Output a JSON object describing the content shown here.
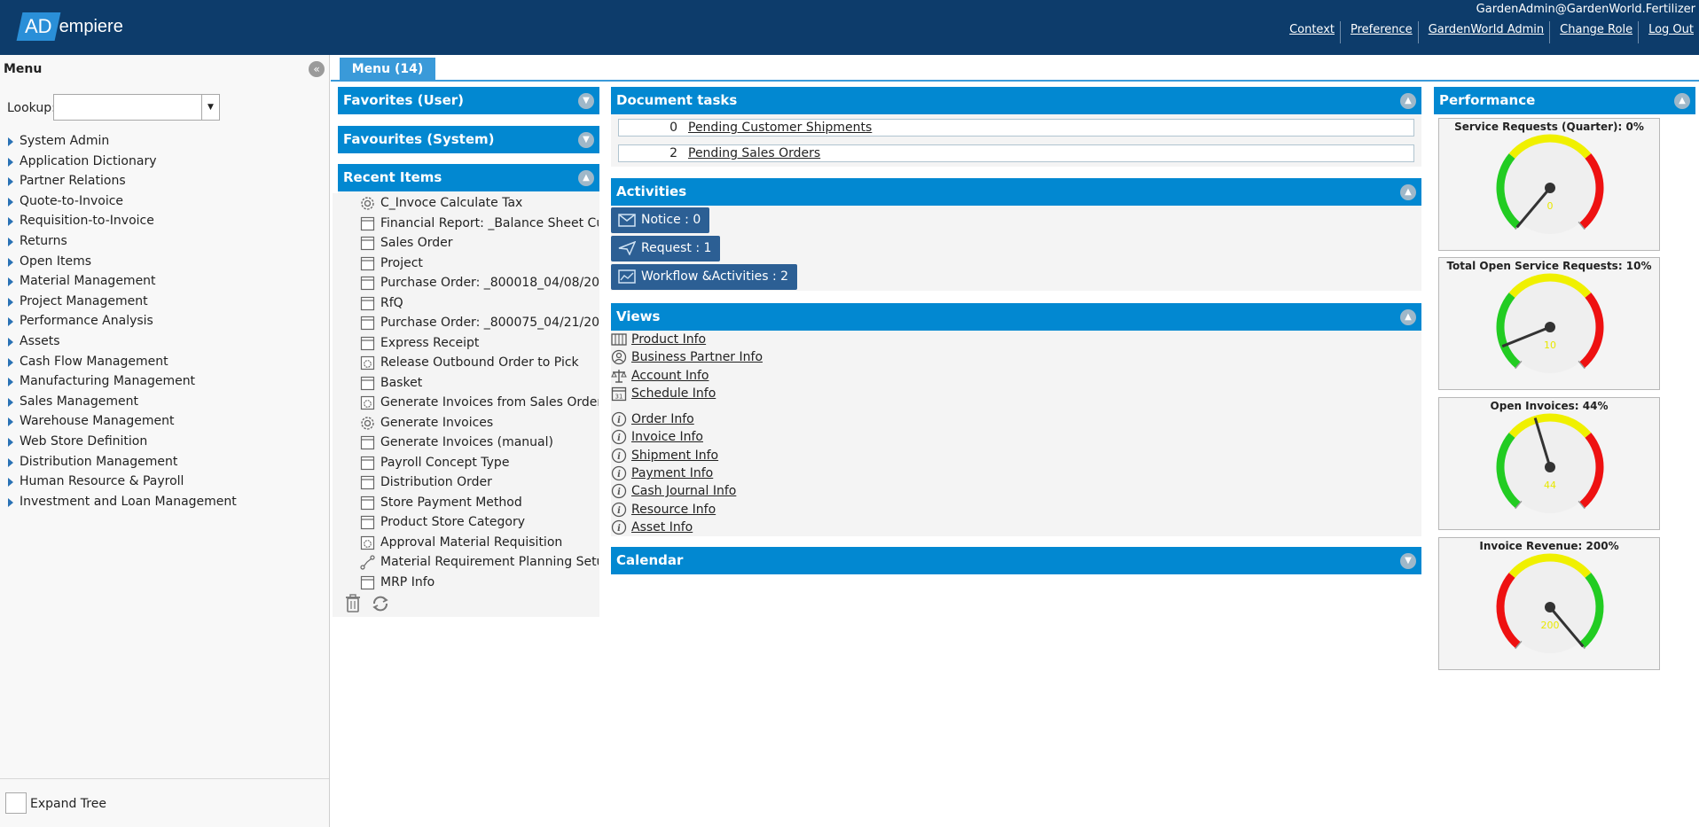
{
  "header": {
    "logo_ad": "AD",
    "logo_rest": "empiere",
    "user": "GardenAdmin@GardenWorld.Fertilizer",
    "links": [
      "Context",
      "Preference",
      "GardenWorld Admin",
      "Change Role",
      "Log Out"
    ]
  },
  "sidebar": {
    "title": "Menu",
    "lookup_label": "Lookup:",
    "lookup_value": "",
    "items": [
      "System Admin",
      "Application Dictionary",
      "Partner Relations",
      "Quote-to-Invoice",
      "Requisition-to-Invoice",
      "Returns",
      "Open Items",
      "Material Management",
      "Project Management",
      "Performance Analysis",
      "Assets",
      "Cash Flow Management",
      "Manufacturing Management",
      "Sales Management",
      "Warehouse Management",
      "Web Store Definition",
      "Distribution Management",
      "Human Resource & Payroll",
      "Investment and Loan Management"
    ],
    "expand_tree_label": "Expand Tree"
  },
  "tabs": {
    "menu_tab": "Menu (14)"
  },
  "panels": {
    "favorites_user": "Favorites (User)",
    "favorites_system": "Favourites (System)",
    "recent_items": "Recent Items",
    "document_tasks": "Document tasks",
    "activities": "Activities",
    "views": "Views",
    "calendar": "Calendar",
    "performance": "Performance"
  },
  "recent": [
    {
      "label": "C_Invoce Calculate Tax",
      "icon": "process-gear-icon"
    },
    {
      "label": "Financial Report: _Balance Sheet Cu",
      "icon": "window-icon"
    },
    {
      "label": "Sales Order",
      "icon": "window-icon"
    },
    {
      "label": "Project",
      "icon": "window-icon"
    },
    {
      "label": "Purchase Order: _800018_04/08/20",
      "icon": "window-icon"
    },
    {
      "label": "RfQ",
      "icon": "window-icon"
    },
    {
      "label": "Purchase Order: _800075_04/21/20",
      "icon": "window-icon"
    },
    {
      "label": "Express Receipt",
      "icon": "window-icon"
    },
    {
      "label": "Release Outbound Order to Pick",
      "icon": "report-gear-icon"
    },
    {
      "label": "Basket",
      "icon": "window-icon"
    },
    {
      "label": "Generate Invoices from Sales Order",
      "icon": "report-gear-icon"
    },
    {
      "label": "Generate Invoices",
      "icon": "process-gear-icon"
    },
    {
      "label": "Generate Invoices (manual)",
      "icon": "window-icon"
    },
    {
      "label": "Payroll Concept Type",
      "icon": "window-icon"
    },
    {
      "label": "Distribution Order",
      "icon": "window-icon"
    },
    {
      "label": "Store Payment Method",
      "icon": "window-icon"
    },
    {
      "label": "Product Store Category",
      "icon": "window-icon"
    },
    {
      "label": "Approval Material Requisition",
      "icon": "report-gear-icon"
    },
    {
      "label": "Material Requirement Planning Setu",
      "icon": "workflow-icon"
    },
    {
      "label": "MRP Info",
      "icon": "window-icon"
    }
  ],
  "document_tasks": [
    {
      "count": "0",
      "label": "Pending Customer Shipments"
    },
    {
      "count": "2",
      "label": "Pending Sales Orders"
    }
  ],
  "activities": [
    {
      "label": "Notice : 0",
      "icon": "notice-icon"
    },
    {
      "label": "Request : 1",
      "icon": "request-icon"
    },
    {
      "label": "Workflow &Activities : 2",
      "icon": "workflow-activities-icon"
    }
  ],
  "views": [
    {
      "label": "Product Info",
      "icon": "product-info-icon"
    },
    {
      "label": "Business Partner Info",
      "icon": "business-partner-icon"
    },
    {
      "label": "Account Info",
      "icon": "account-scale-icon"
    },
    {
      "label": "Schedule Info",
      "icon": "calendar-icon"
    },
    {
      "label": "Order Info",
      "icon": "info-icon"
    },
    {
      "label": "Invoice Info",
      "icon": "info-icon"
    },
    {
      "label": "Shipment Info",
      "icon": "info-icon"
    },
    {
      "label": "Payment Info",
      "icon": "info-icon"
    },
    {
      "label": "Cash Journal Info",
      "icon": "info-icon"
    },
    {
      "label": "Resource Info",
      "icon": "info-icon"
    },
    {
      "label": "Asset Info",
      "icon": "info-icon"
    }
  ],
  "gauges": [
    {
      "title": "Service Requests (Quarter): 0%",
      "value": 0,
      "reversed": false
    },
    {
      "title": "Total Open Service Requests: 10%",
      "value": 10,
      "reversed": false
    },
    {
      "title": "Open Invoices: 44%",
      "value": 44,
      "reversed": false
    },
    {
      "title": "Invoice Revenue: 200%",
      "value": 200,
      "reversed": true
    }
  ],
  "colors": {
    "header_bg": "#0d3c6b",
    "panel_header": "#0288d1",
    "activity_button": "#2c5f94",
    "gauge_green": "#22cc22",
    "gauge_yellow": "#f0f000",
    "gauge_red": "#ee1111"
  }
}
